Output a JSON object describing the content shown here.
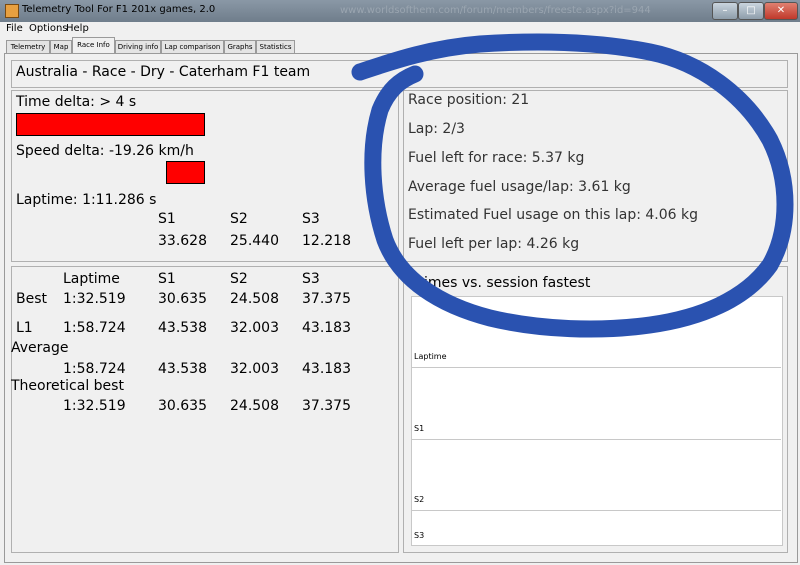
{
  "window": {
    "title": "Telemetry Tool For F1 201x games, 2.0",
    "background_url": "www.worldsofthem.com/forum/members/freeste.aspx?id=944",
    "minimize_label": "–",
    "maximize_label": "□",
    "close_label": "✕"
  },
  "menu": [
    "File",
    "Options",
    "Help"
  ],
  "tabs": [
    "Telemetry",
    "Map",
    "Race Info",
    "Driving info",
    "Lap comparison",
    "Graphs",
    "Statistics"
  ],
  "active_tab": "Race Info",
  "header": "Australia - Race - Dry - Caterham F1 team",
  "delta": {
    "time_delta": "Time delta: > 4 s",
    "speed_delta": "Speed delta: -19.26 km/h",
    "laptime": "Laptime: 1:11.286 s",
    "sector_headers": [
      "S1",
      "S2",
      "S3"
    ],
    "sector_values": [
      "33.628",
      "25.440",
      "12.218"
    ],
    "bar_color": "#ff0000"
  },
  "fuel": {
    "race_position": "Race position: 21",
    "lap": "Lap: 2/3",
    "fuel_left_race": "Fuel left for race: 5.37 kg",
    "avg_fuel": "Average fuel usage/lap: 3.61 kg",
    "est_fuel": "Estimated Fuel usage on this lap: 4.06 kg",
    "fuel_per_lap": "Fuel left per lap: 4.26 kg"
  },
  "laps": {
    "headers": [
      "Laptime",
      "S1",
      "S2",
      "S3"
    ],
    "best": {
      "label": "Best",
      "values": [
        "1:32.519",
        "30.635",
        "24.508",
        "37.375"
      ]
    },
    "l1": {
      "label": "L1",
      "values": [
        "1:58.724",
        "43.538",
        "32.003",
        "43.183"
      ]
    },
    "average": {
      "label": "Average",
      "values": [
        "1:58.724",
        "43.538",
        "32.003",
        "43.183"
      ]
    },
    "theoretical": {
      "label": "Theoretical best",
      "values": [
        "1:32.519",
        "30.635",
        "24.508",
        "37.375"
      ]
    }
  },
  "chart": {
    "title": "imes vs. session fastest",
    "rows": [
      "Laptime",
      "S1",
      "S2",
      "S3"
    ]
  },
  "annotation_color": "#2a52b0"
}
